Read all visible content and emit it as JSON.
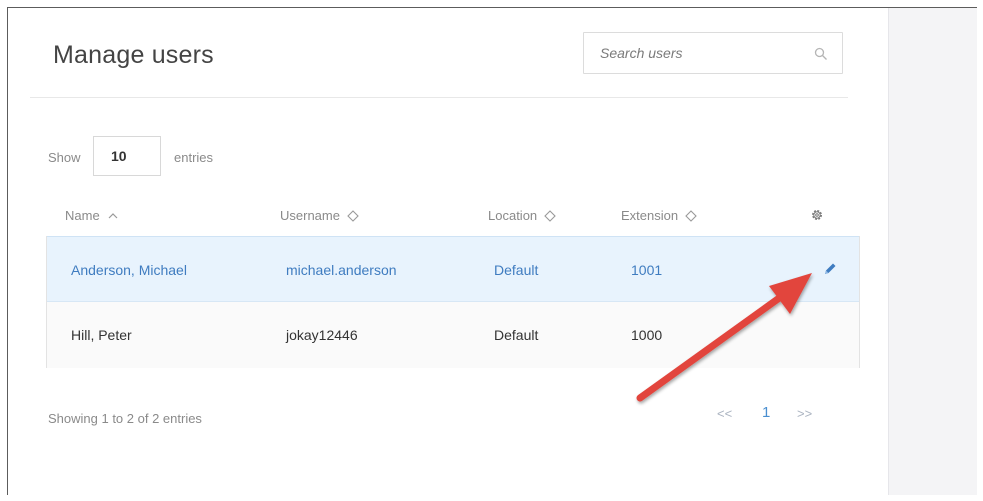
{
  "page": {
    "title": "Manage users"
  },
  "search": {
    "placeholder": "Search users",
    "icon": "search-icon"
  },
  "length_control": {
    "show_label": "Show",
    "value": "10",
    "entries_label": "entries"
  },
  "table": {
    "columns": [
      {
        "label": "Name",
        "sort": "ascending"
      },
      {
        "label": "Username",
        "sort": "none"
      },
      {
        "label": "Location",
        "sort": "none"
      },
      {
        "label": "Extension",
        "sort": "none"
      }
    ],
    "settings_icon": "gear-icon",
    "rows": [
      {
        "name": "Anderson, Michael",
        "username": "michael.anderson",
        "location": "Default",
        "extension": "1001",
        "selected": true,
        "action_icon": "pencil-icon"
      },
      {
        "name": "Hill, Peter",
        "username": "jokay12446",
        "location": "Default",
        "extension": "1000",
        "selected": false
      }
    ]
  },
  "footer": {
    "info": "Showing 1 to 2 of 2 entries",
    "pagination": {
      "prev": "<<",
      "current": "1",
      "next": ">>"
    }
  },
  "colors": {
    "accent": "#3f7cc0",
    "selected_row": "#e8f3fd",
    "annotation_arrow": "#e2453c"
  }
}
